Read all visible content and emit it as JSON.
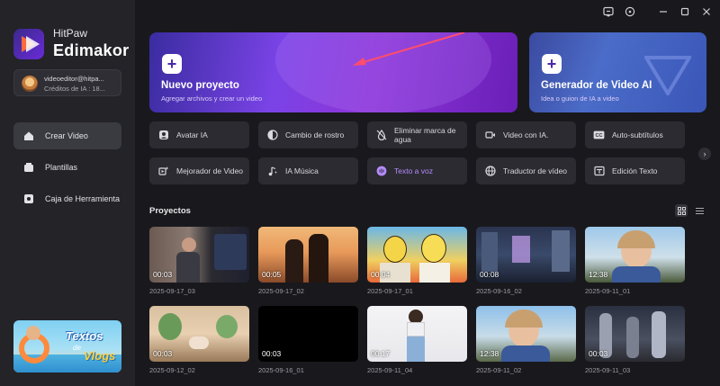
{
  "brand": {
    "top": "HitPaw",
    "main": "Edimakor"
  },
  "account": {
    "email": "videoeditor@hitpa...",
    "credits": "Créditos de IA : 18..."
  },
  "nav": [
    {
      "label": "Crear Video",
      "icon": "home-icon",
      "active": true
    },
    {
      "label": "Plantillas",
      "icon": "template-icon",
      "active": false
    },
    {
      "label": "Caja de Herramienta",
      "icon": "toolbox-icon",
      "active": false
    }
  ],
  "banner": {
    "line1": "Textos",
    "line2": "de",
    "line3": "Vlogs"
  },
  "hero": {
    "new_project": {
      "title": "Nuevo proyecto",
      "subtitle": "Agregar archivos y crear un video"
    },
    "ai_generator": {
      "title": "Generador de Video AI",
      "subtitle": "Idea o guion de IA a video"
    }
  },
  "features": [
    {
      "label": "Avatar IA",
      "icon": "avatar-icon"
    },
    {
      "label": "Cambio de rostro",
      "icon": "face-swap-icon"
    },
    {
      "label": "Eliminar marca de agua",
      "icon": "watermark-remove-icon"
    },
    {
      "label": "Video con IA.",
      "icon": "ai-video-icon"
    },
    {
      "label": "Auto-subtítulos",
      "icon": "cc-icon"
    },
    {
      "label": "Mejorador de Video",
      "icon": "video-enhance-icon"
    },
    {
      "label": "IA Música",
      "icon": "music-icon"
    },
    {
      "label": "Texto a voz",
      "icon": "tts-icon"
    },
    {
      "label": "Traductor de vídeo",
      "icon": "translate-icon"
    },
    {
      "label": "Edición Texto",
      "icon": "text-edit-icon"
    }
  ],
  "projects": {
    "title": "Proyectos",
    "items": [
      {
        "name": "2025-09-17_03",
        "duration": "00:03"
      },
      {
        "name": "2025-09-17_02",
        "duration": "00:05"
      },
      {
        "name": "2025-09-17_01",
        "duration": "00:04"
      },
      {
        "name": "2025-09-16_02",
        "duration": "00:08"
      },
      {
        "name": "2025-09-11_01",
        "duration": "12:38"
      },
      {
        "name": "2025-09-12_02",
        "duration": "00:03"
      },
      {
        "name": "2025-09-16_01",
        "duration": "00:03"
      },
      {
        "name": "2025-09-11_04",
        "duration": "00:17"
      },
      {
        "name": "2025-09-11_02",
        "duration": "12:38"
      },
      {
        "name": "2025-09-11_03",
        "duration": "00:03"
      }
    ]
  },
  "colors": {
    "accent": "#7a43e6",
    "purple_text": "#b58cff",
    "sidebar": "#232328",
    "background": "#19191d"
  }
}
